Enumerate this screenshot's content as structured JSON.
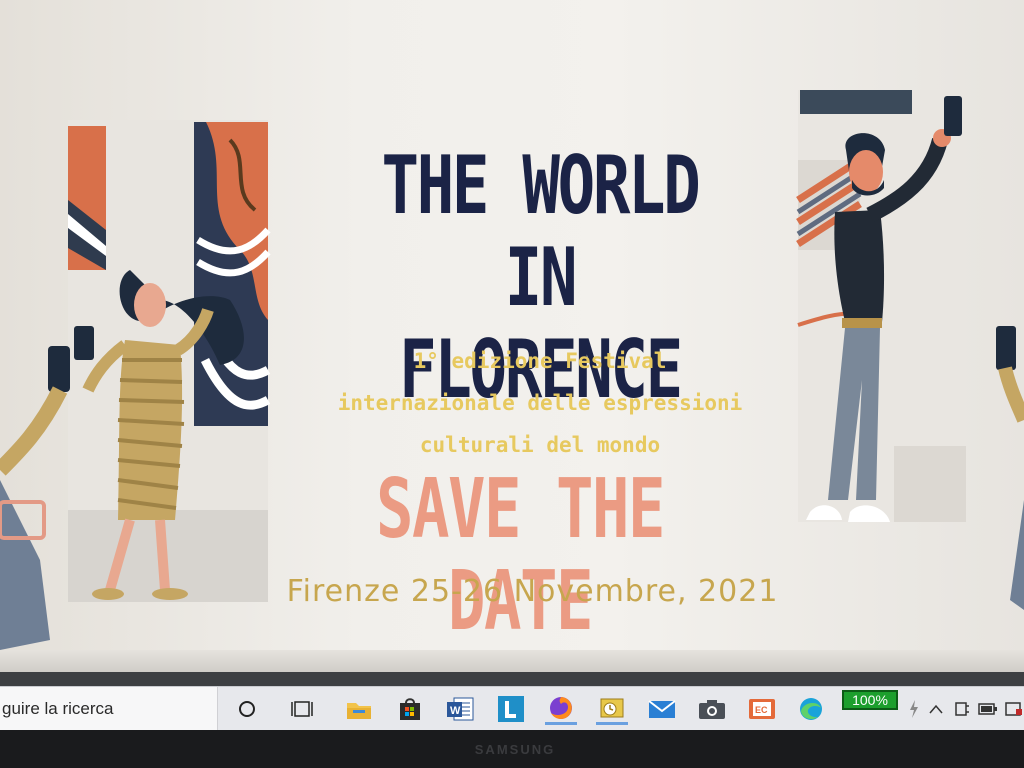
{
  "poster": {
    "title_line1": "THE WORLD IN",
    "title_line2": "FLORENCE",
    "subtitle_line1": "1° edizione Festival",
    "subtitle_line2": "internazionale delle espressioni",
    "subtitle_line3": "culturali del mondo",
    "save_the_date": "SAVE THE DATE",
    "dates": "Firenze 25-26 Novembre, 2021"
  },
  "taskbar": {
    "search_text": "guire la ricerca",
    "battery_label": "100%",
    "icons": [
      "cortana-circle-icon",
      "task-view-icon",
      "file-explorer-icon",
      "store-icon",
      "word-icon",
      "l-app-icon",
      "firefox-icon",
      "outlook-icon",
      "mail-icon",
      "camera-icon",
      "pdf-icon",
      "edge-icon"
    ]
  },
  "monitor": {
    "brand": "SAMSUNG"
  },
  "colors": {
    "title": "#1b2346",
    "subtitle": "#e7c95f",
    "save_the_date": "#eb9b83",
    "dates": "#c7a64e",
    "battery": "#1c9f2d"
  }
}
